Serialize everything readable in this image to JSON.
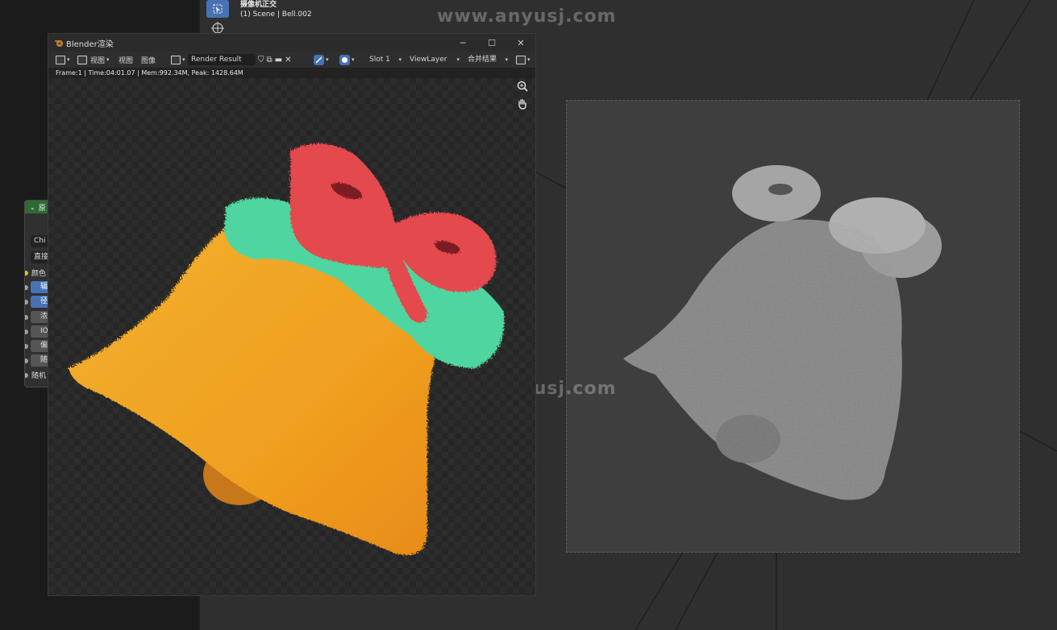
{
  "viewport": {
    "header_line1": "摄像机正交",
    "header_line2": "(1) Scene | Bell.002",
    "watermark": "www.anyusj.com"
  },
  "node_panel": {
    "title": "原",
    "items": [
      "Chi",
      "直接",
      "颜色",
      "辐",
      "径",
      "浓",
      "IO",
      "偏",
      "随",
      "随机"
    ]
  },
  "render_window": {
    "title": "Blender渲染",
    "controls": {
      "minimize": "─",
      "maximize": "☐",
      "close": "✕"
    },
    "menu": {
      "view": "视图",
      "view2": "视图",
      "image": "图像"
    },
    "image_name": "Render Result",
    "slot": "Slot 1",
    "view_layer": "ViewLayer",
    "pass": "合并结果",
    "stats": "Frame:1 | Time:04:01.07 | Mem:992.34M, Peak: 1428.64M"
  },
  "colors": {
    "accent": "#4772b3",
    "node_header": "#2f6a35",
    "bell_yellow": "#f0a525",
    "bow_red": "#e4484d",
    "leaf_green": "#4fd6a0"
  },
  "icons": [
    "select-box-icon",
    "cursor-icon",
    "blender-logo-icon",
    "zoom-icon",
    "hand-icon"
  ]
}
